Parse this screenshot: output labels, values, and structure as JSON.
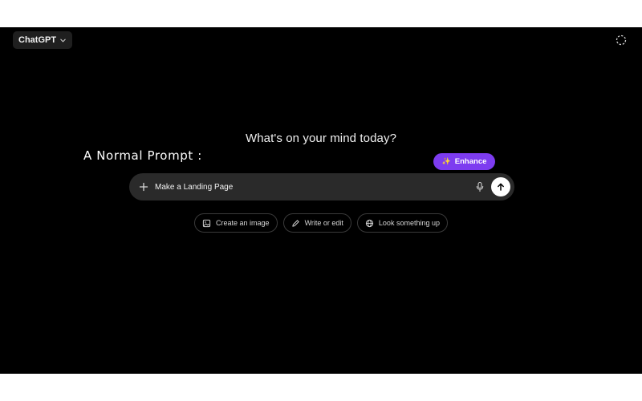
{
  "header": {
    "model_label": "ChatGPT",
    "model_icon": "chevron-down-icon",
    "temporary_chat_icon": "dashed-circle-icon"
  },
  "main": {
    "headline": "What's on your mind today?",
    "annotation": "A Normal Prompt :"
  },
  "enhance": {
    "label": "Enhance",
    "icon": "sparkle-icon",
    "color": "#7d3cf0"
  },
  "composer": {
    "value": "Make a Landing Page",
    "placeholder": "",
    "left_icon": "plus-icon",
    "mic_icon": "microphone-icon",
    "send_icon": "arrow-up-icon"
  },
  "chips": [
    {
      "label": "Create an image",
      "icon": "image-icon"
    },
    {
      "label": "Write or edit",
      "icon": "pencil-icon"
    },
    {
      "label": "Look something up",
      "icon": "globe-icon"
    }
  ],
  "colors": {
    "background": "#000000",
    "composer": "#2a2a2a",
    "text": "#ececec"
  }
}
